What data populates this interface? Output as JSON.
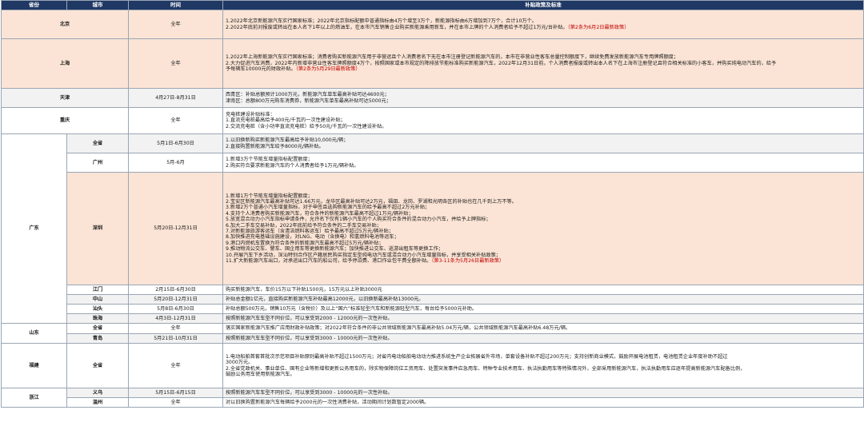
{
  "headers": {
    "province": "省份",
    "city": "城市",
    "period": "时间",
    "policy": "补贴政策及标准"
  },
  "rows": {
    "beijing": {
      "province": "北京",
      "period": "全年",
      "lines": [
        "1.2022年北京新能源汽车实行国家标准；2022年北京指标配额中普通指标由4万个增至3万个，新能源指标由6万增加到7万个，合计10万个。",
        "2.2022年底前对报废或转出在本人名下1年以上的燃油车，在本市汽车销售企业购买新能源乘用新车，并在本市上牌的个人消费者给予不超过1万元/台补贴。（第2条为6月2日最新政策）"
      ]
    },
    "shanghai": {
      "province": "上海",
      "period": "全年",
      "lines": [
        "1.2022年上海新能源汽车实行国家标准；消费者购买新能源汽车用于非营运且个人消费者名下无在本市注册登记新能源汽车的，本市在非营业性客车总量控制额度下，继续免费发放新能源汽车专用牌照额度；",
        "2.大力促进汽车消费，2022年内新增非营业性客车牌照额度4万个，按照国家或本市规定的降排放节能标准购买新能源汽车，2022年12月31日前，个人消费者报废或转出本人名下在上海市注册登记且符合相关标准的小客车，并购买纯电动汽车的，给予",
        "予每辆车10000元的财政补贴。（第2条为5月29日最新政策）"
      ]
    },
    "tianjin": {
      "province": "天津",
      "period": "4月27日-8月31日",
      "lines": [
        "西青区：补贴总额预计1000万元，新能源汽车单车最高补贴可达4600元；",
        "津南区：总额800万元购车消费券，新能源汽车单车最高补贴可达5000元；"
      ]
    },
    "chongqing": {
      "province": "重庆",
      "period": "全年",
      "lines": [
        "充电桩建设补贴标准：",
        "1.直流充电桩最高给予400元/千瓦的一次性建设补贴；",
        "2.交流充电桩（含小功率直流充电桩）给予50元/千瓦的一次性建设补贴。"
      ]
    },
    "guangdong": {
      "province": "广东",
      "sheng": {
        "city": "全省",
        "period": "5月1日-6月30日",
        "lines": [
          "1.以旧换新购买新能源汽车最高给予补贴10,000元/辆；",
          "2.直接购置新能源汽车给予8000元/辆补贴。"
        ]
      },
      "guangzhou": {
        "city": "广州",
        "period": "5月-6月",
        "lines": [
          "1.新增3万个节能车增量指标配置额度；",
          "2.购买符合要求新能源汽车的个人消费者给予1万元/辆补贴。"
        ]
      },
      "shenzhen": {
        "city": "深圳",
        "period": "5月20日-12月31日",
        "lines": [
          "1.新增1万个节能车增量指标配置额度；",
          "2.宝安区新能源汽车最高补贴可达1.66万元，龙华区最高补贴可达2万元，福田、龙岗、罗湖和光明各区的补贴也在几千到上万不等。",
          "3.新增2万个普通小汽车增量指标，对于申签且选购新能源汽车的给予最高不超过2万元补贴；",
          "4.支持个人消费者购买新能源汽车，符合条件的新能源汽车最高不超过1万元/辆补贴；",
          "5.放宽混合动力小汽车指标申请条件，允许名下仅有1辆小汽车的个人购买符合条件的混合动力小汽车，并给予上牌指标；",
          "6.加大二手车交易补贴，2022年底前给予符合条件的二手车交易补贴；",
          "7.对新能源旅游客运车（含清洁燃料客运车）给予最高不超过5万元/辆补贴；",
          "8.加快推进充电基础设施建设，对LNG、电动（含换电）和氢燃料电池等运车；",
          "9.港口内燃机车置换为符合条件的新能源汽车最高不超过5万元/辆补贴；",
          "9.推动物流公交车、警车、国企用车等更换新能源汽车；加快推进公交车、巡游出租车等更换工作；",
          "10.开展汽车下乡活动，深汕特别合作区户籍居民购买指定车型纯电动汽车或混合动力小汽车增量指标，并享受相关补贴政策；",
          "11.扩大新能源汽车出口，对承运出口汽车的船公司，给予停泊费、港口作业包干费全额补贴。（第3-11条为5月26日最新政策）"
        ]
      },
      "jiangmen": {
        "city": "江门",
        "period": "2月15日-6月30日",
        "lines": [
          "购买新能源汽车，车价15万以下补贴1500元，15万元以上补贴3000元"
        ]
      },
      "zhongshan": {
        "city": "中山",
        "period": "5月20日-12月31日",
        "lines": [
          "补贴总金额1亿元，直接购买新能源汽车补贴最高12000元，以旧换新最高补贴13000元。"
        ]
      },
      "shantou": {
        "city": "汕头",
        "period": "5月8日-6月30日",
        "lines": [
          "补贴总额500万元，销售10万元（含税价）及以上“国六”标准轻型汽车和新能源轻型汽车，每台给予5000元补助。"
        ]
      },
      "zhuhai": {
        "city": "珠海",
        "period": "4月3日-12月31日",
        "lines": [
          "按照新能源汽车车型不同价位，可以享受到2000 - 12000元的一次性补贴。"
        ]
      }
    },
    "shandong": {
      "province": "山东",
      "sheng": {
        "city": "全省",
        "period": "全年",
        "lines": [
          "落实国家新能源汽车推广应用财政补贴政策；对2022年符合条件的非公共领域新能源汽车最高补贴5.04万元/辆，公共领域新能源汽车最高补贴6.48万元/辆。"
        ]
      },
      "qingdao": {
        "city": "青岛",
        "period": "5月21日-10月31日",
        "lines": [
          "按照新能源汽车车型不同价位，可以享受到3000 - 10000元的一次性补贴。"
        ]
      }
    },
    "fujian": {
      "province": "福建",
      "sheng": {
        "city": "全省",
        "period": "全年",
        "lines": [
          "1.电动船舶首套首批次示范项目补贴原则最高补贴不超过1500万元；对省内电动船舶电动动力推进系统生产企业拓展省外市场，单套设备补贴不超过200万元；支持创新商业模式，鼓励开展电池租赁，电池租赁企业年度补助不超过",
          "3000万元。",
          "2.全省党政机关、事业单位、国有企业等新增和更新公务用车的，除实物保障岗位工资用车、处置突发事件应急用车、特种专业技术用车、执法执勤用车等特殊情况外，全部采用新能源汽车，执法执勤用车应逐年提高新能源汽车配备比例，",
          "鼓励公务用车使用新能源汽车。"
        ]
      }
    },
    "zhejiang": {
      "province": "浙江",
      "yiwu": {
        "city": "义乌",
        "period": "5月15日-6月15日",
        "lines": [
          "按照新能源汽车车型不同价位，可以享受到3000 - 10000元的一次性补贴。"
        ]
      },
      "wenzhou": {
        "city": "温州",
        "period": "全年",
        "lines": [
          "对以旧换购置新能源汽车每辆给予2000元的一次性消费补贴，活动期间计划数暂定2000辆。"
        ]
      }
    }
  }
}
